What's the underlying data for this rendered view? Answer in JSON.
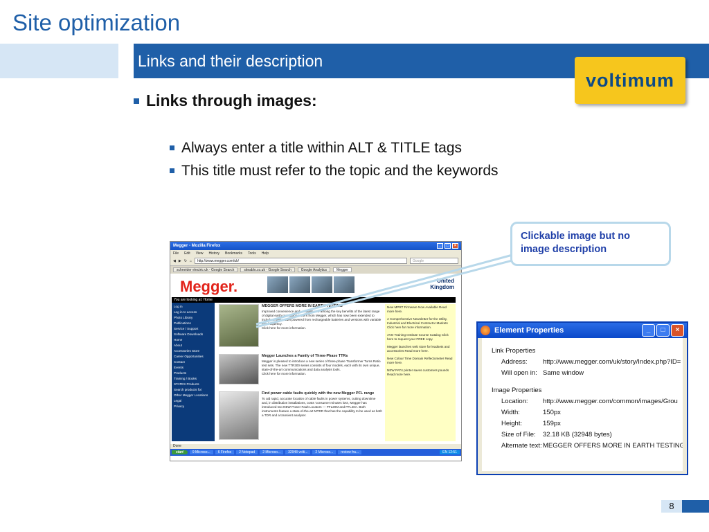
{
  "slide": {
    "title": "Site optimization",
    "subtitle": "Links and their description",
    "logo_text": "voltimum",
    "bullet_main": "Links through images:",
    "sub_bullets": [
      "Always enter a title within ALT & TITLE tags",
      "This title must refer to the topic and the keywords"
    ],
    "callout": "Clickable image but no image description",
    "page_number": "8"
  },
  "colors": {
    "brand_blue": "#1f5fa8",
    "logo_yellow": "#f6c61d",
    "megger_red": "#e2231a"
  },
  "browser": {
    "title": "Megger - Mozilla Firefox",
    "menu": [
      "File",
      "Edit",
      "View",
      "History",
      "Bookmarks",
      "Tools",
      "Help"
    ],
    "url": "http://www.megger.com/uk/",
    "search_placeholder": "Google",
    "tabs": [
      "schneider electric uk - Google Search",
      "siteablo.co.uk - Google Search",
      "Google Analytics",
      "Megger"
    ],
    "site": {
      "logo": "Megger.",
      "country": "United Kingdom",
      "breadcrumb": "You are looking at: Home",
      "side_nav": [
        "Log in",
        "Log in to access",
        "Photo Library",
        "Publications",
        "Service / Support",
        "Software Downloads",
        "Home",
        "About",
        "Accessories Store",
        "Career Opportunities",
        "Contact",
        "Events",
        "Products",
        "Training / Books",
        "STATES Products",
        "Search products for:",
        "Other Megger Locations",
        "Legal",
        "Privacy"
      ],
      "articles": [
        {
          "head": "MEGGER OFFERS MORE IN EARTH TESTING",
          "body": "Improved convenience and versatility are among the key benefits of the latest range of digital earth resistance testers from Megger, which has now been extended to include a new model powered from rechargeable batteries and versions with variable test frequency.",
          "more": "Click here for more information."
        },
        {
          "head": "Megger Launches a Family of Three-Phase TTRs",
          "body": "Megger is pleased to introduce a new series of three-phase Transformer Turns Ratio test sets. The new TTR300 series consists of four models, each with its own unique, state-of-the-art communications and data analysis tools.",
          "more": "Click here for more information."
        },
        {
          "head": "Find power cable faults quickly with the new Megger PFL range",
          "body": "To aid rapid, accurate location of cable faults in power systems, cutting downtime and, in distribution installations, costs 'consumer minutes lost', Megger has introduced two NEW Power Fault Locators — PFL20M and PFL40A. Both instruments feature a state-of-the-art MTDR that has the capability to be used as both a TDR and a transient analyser.",
          "more": ""
        }
      ],
      "news": [
        "New MPRT Firmware Now Available Read more here.",
        "A Comprehensive Newsletter for the Utility, Industrial and Electrical Contractor Markets Click here for more information.",
        "AVO Training Institute Course Catalog Click here to request your FREE copy.",
        "Megger launches web store for leadsets and accessories Read more here.",
        "New Colour Time Domain Reflectometer Read more here.",
        "NEW PAT4 printer saves customers pounds Read more here."
      ]
    },
    "status": "Done",
    "taskbar": {
      "start": "start",
      "items": [
        "9 Microso...",
        "6 Firefox",
        "2 Notepad",
        "2 Microso...",
        "32948 volti...",
        "2 Microso...",
        "review fra..."
      ],
      "tray": "EN 12:51"
    }
  },
  "dialog": {
    "title": "Element Properties",
    "link_section": "Link Properties",
    "link_rows": [
      {
        "key": "Address:",
        "value": "http://www.megger.com/uk/story/Index.php?ID="
      },
      {
        "key": "Will open in:",
        "value": "Same window"
      }
    ],
    "image_section": "Image Properties",
    "image_rows": [
      {
        "key": "Location:",
        "value": "http://www.megger.com/common/images/Grou"
      },
      {
        "key": "Width:",
        "value": "150px"
      },
      {
        "key": "Height:",
        "value": "159px"
      },
      {
        "key": "Size of File:",
        "value": "32.18 KB (32948 bytes)"
      },
      {
        "key": "Alternate text:",
        "value": "MEGGER OFFERS MORE IN EARTH TESTING"
      }
    ]
  }
}
